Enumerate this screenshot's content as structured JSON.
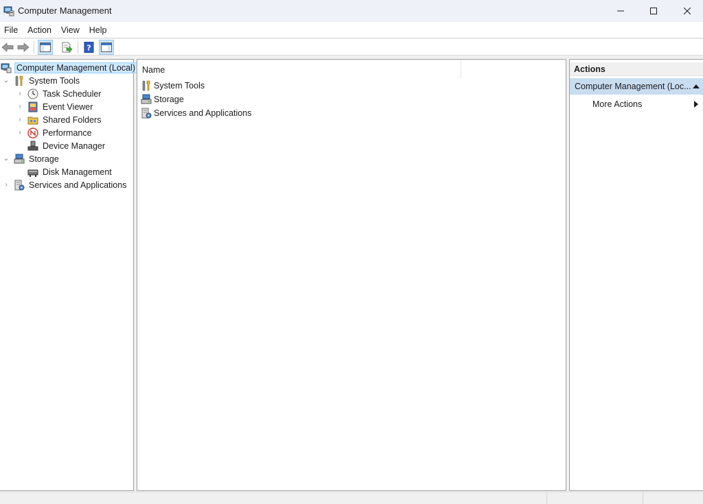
{
  "window": {
    "title": "Computer Management",
    "icon": "computer-management-icon"
  },
  "menu": [
    "File",
    "Action",
    "View",
    "Help"
  ],
  "toolbar": {
    "buttons": [
      "back-arrow-icon",
      "forward-arrow-icon",
      "show-hide-console-tree-icon",
      "export-list-icon",
      "help-icon",
      "show-hide-action-pane-icon"
    ]
  },
  "tree": {
    "root": "Computer Management (Local)",
    "system_tools": "System Tools",
    "task_scheduler": "Task Scheduler",
    "event_viewer": "Event Viewer",
    "shared_folders": "Shared Folders",
    "performance": "Performance",
    "device_manager": "Device Manager",
    "storage": "Storage",
    "disk_management": "Disk Management",
    "services": "Services and Applications"
  },
  "list": {
    "column_name": "Name",
    "items": [
      "System Tools",
      "Storage",
      "Services and Applications"
    ]
  },
  "actions": {
    "header": "Actions",
    "selected": "Computer Management (Loc...",
    "more": "More Actions"
  },
  "colors": {
    "selection": "#cce8ff",
    "actions_selected": "#c9ddf1",
    "titlebar": "#eef1f8"
  }
}
